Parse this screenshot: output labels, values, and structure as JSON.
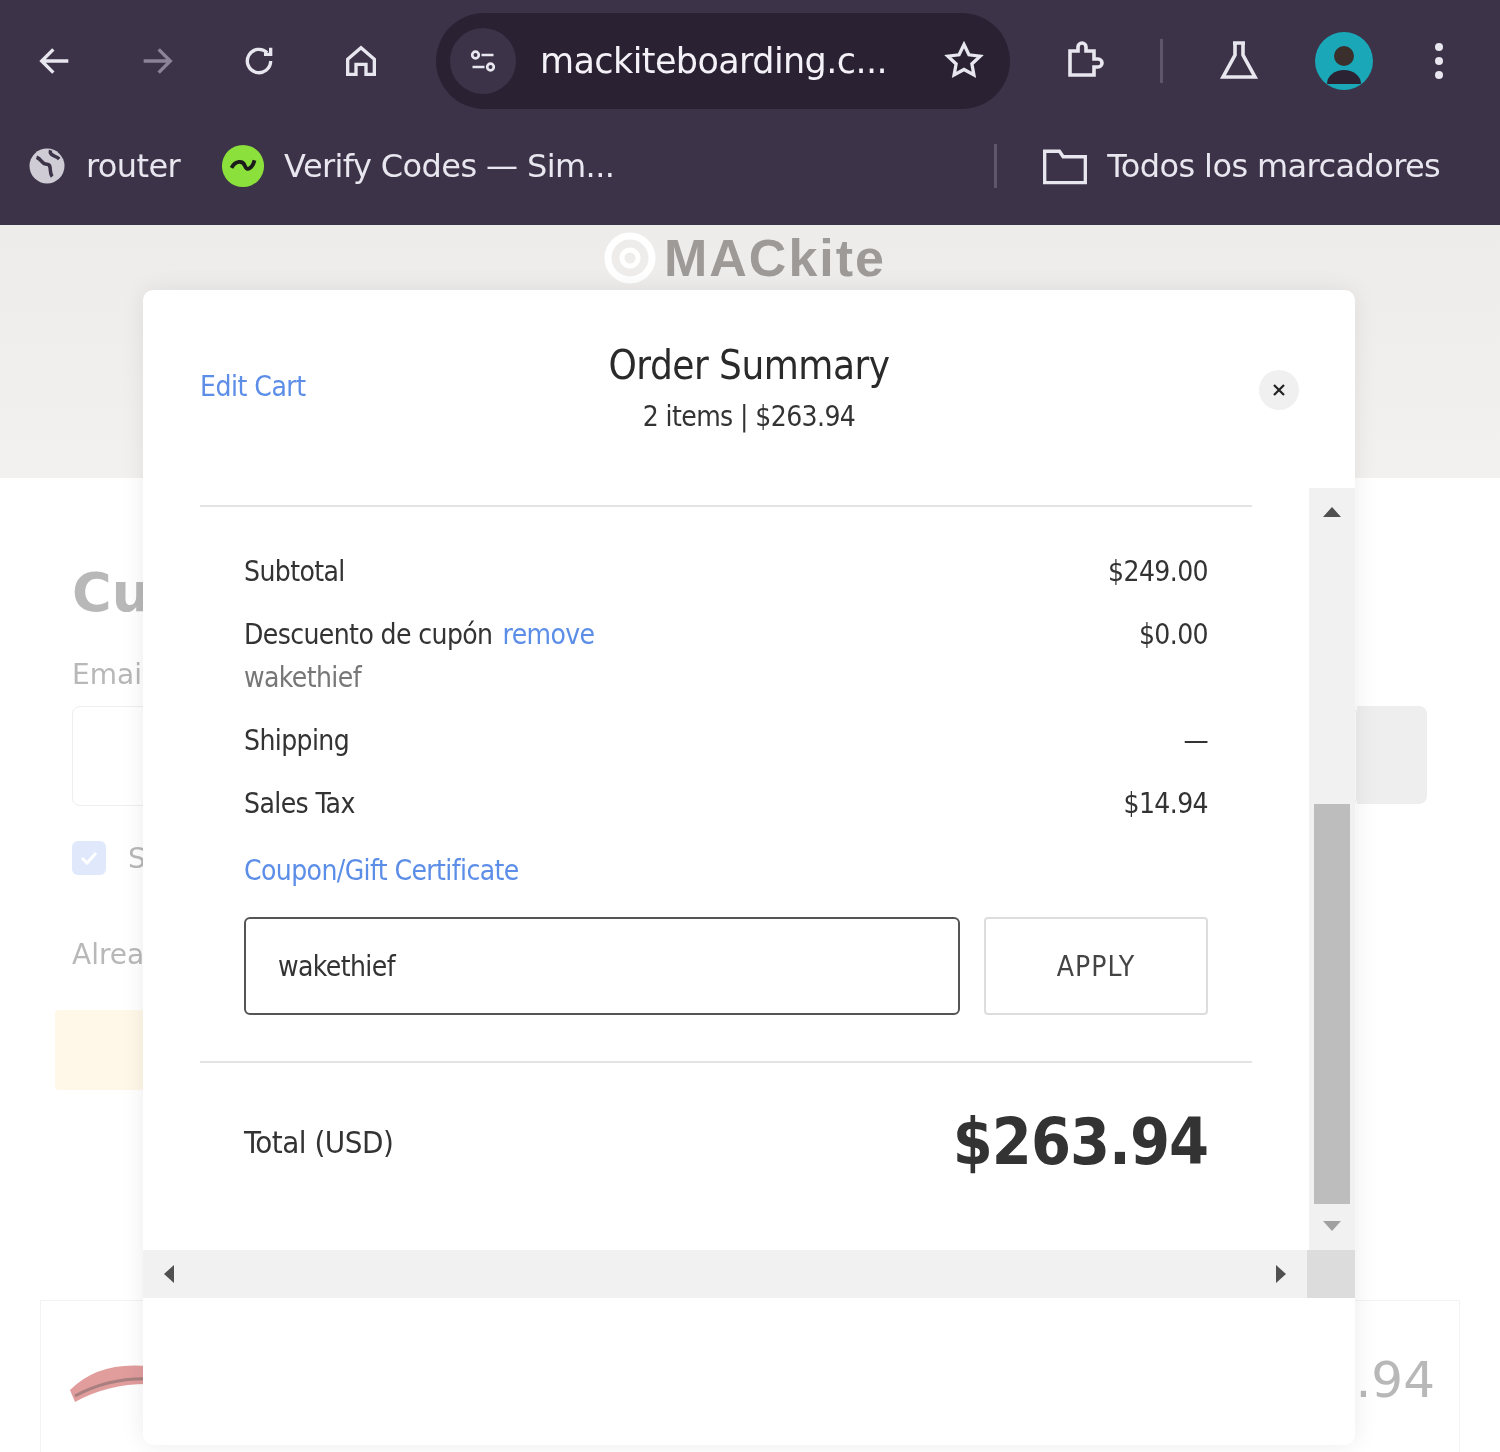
{
  "browser": {
    "nav": [
      {
        "kind": "back",
        "disabled": false
      },
      {
        "kind": "forward",
        "disabled": true
      },
      {
        "kind": "reload",
        "disabled": false
      },
      {
        "kind": "home",
        "disabled": false
      }
    ],
    "url": "mackiteboarding.c...",
    "bookmarks": [
      {
        "kind": "globe",
        "label": "router"
      },
      {
        "kind": "app",
        "label": "Verify Codes — Sim..."
      }
    ],
    "all_bookmarks": "Todos los marcadores"
  },
  "page": {
    "logo": "MACkite",
    "heading": "Cu",
    "email_label": "Emai",
    "checkbox": {
      "checked": true,
      "label": "S"
    },
    "already": "Alrea",
    "price": ".94"
  },
  "modal": {
    "edit_cart": "Edit Cart",
    "title": "Order Summary",
    "subtitle": "2 items | $263.94",
    "rows": [
      {
        "label": "Subtotal",
        "value": "$249.00"
      },
      {
        "label": "Descuento de cupón",
        "link": "remove",
        "note": "wakethief",
        "value": "$0.00"
      },
      {
        "label": "Shipping",
        "value": "—"
      },
      {
        "label": "Sales Tax",
        "value": "$14.94"
      }
    ],
    "coupon_link": "Coupon/Gift Certificate",
    "coupon_value": "wakethief",
    "apply": "APPLY",
    "total_label": "Total (USD)",
    "total": "$263.94"
  }
}
